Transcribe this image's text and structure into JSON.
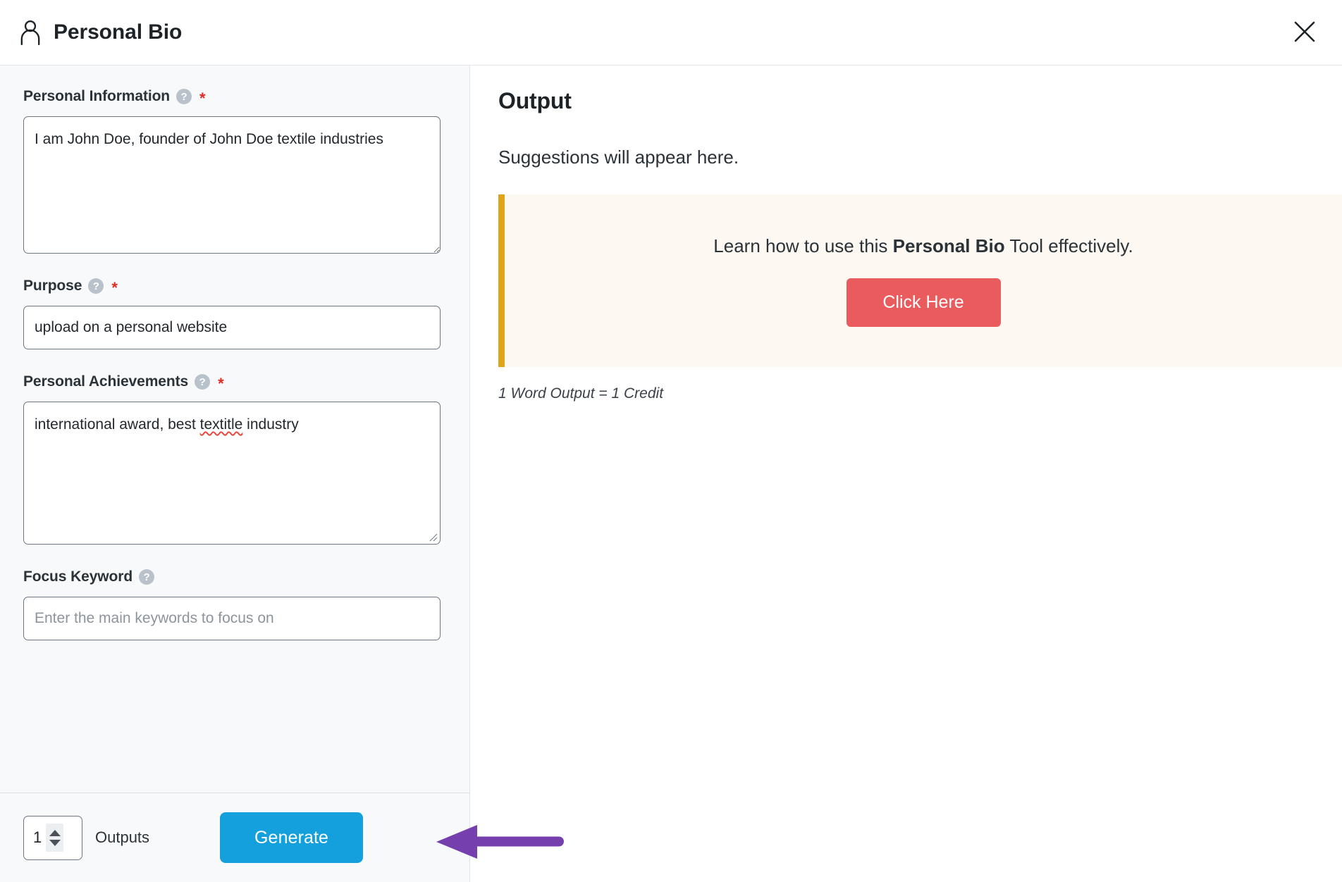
{
  "header": {
    "title": "Personal Bio",
    "person_icon": "person-icon",
    "close_icon": "close-icon"
  },
  "form": {
    "fields": [
      {
        "label": "Personal Information",
        "help_icon": "question-mark-icon",
        "required": true,
        "required_mark": "*",
        "type": "textarea",
        "value": "I am John Doe, founder of John Doe textile industries",
        "placeholder": ""
      },
      {
        "label": "Purpose",
        "help_icon": "question-mark-icon",
        "required": true,
        "required_mark": "*",
        "type": "text",
        "value": "upload on a personal website",
        "placeholder": ""
      },
      {
        "label": "Personal Achievements",
        "help_icon": "question-mark-icon",
        "required": true,
        "required_mark": "*",
        "type": "textarea",
        "value": "international award, best textitle industry",
        "value_prefix": "international award, best ",
        "value_misspelled": "textitle",
        "value_suffix": " industry",
        "placeholder": ""
      },
      {
        "label": "Focus Keyword",
        "help_icon": "question-mark-icon",
        "required": false,
        "required_mark": "",
        "type": "text",
        "value": "",
        "placeholder": "Enter the main keywords to focus on"
      }
    ]
  },
  "footer": {
    "outputs_value": "1",
    "outputs_label": "Outputs",
    "generate_label": "Generate",
    "generate_color": "#14a0dd",
    "stepper_up_icon": "chevron-up-icon",
    "stepper_down_icon": "chevron-down-icon"
  },
  "output": {
    "title": "Output",
    "placeholder_text": "Suggestions will appear here.",
    "notice": {
      "text_before": "Learn how to use this ",
      "text_bold": "Personal Bio",
      "text_after": " Tool effectively.",
      "button_label": "Click Here",
      "button_color": "#e95b5c",
      "accent_color": "#e0a31c",
      "background_color": "#fdf8f1"
    },
    "credit_note": "1 Word Output = 1 Credit"
  },
  "annotation": {
    "arrow_color": "#7540ad",
    "arrow_direction": "left"
  }
}
